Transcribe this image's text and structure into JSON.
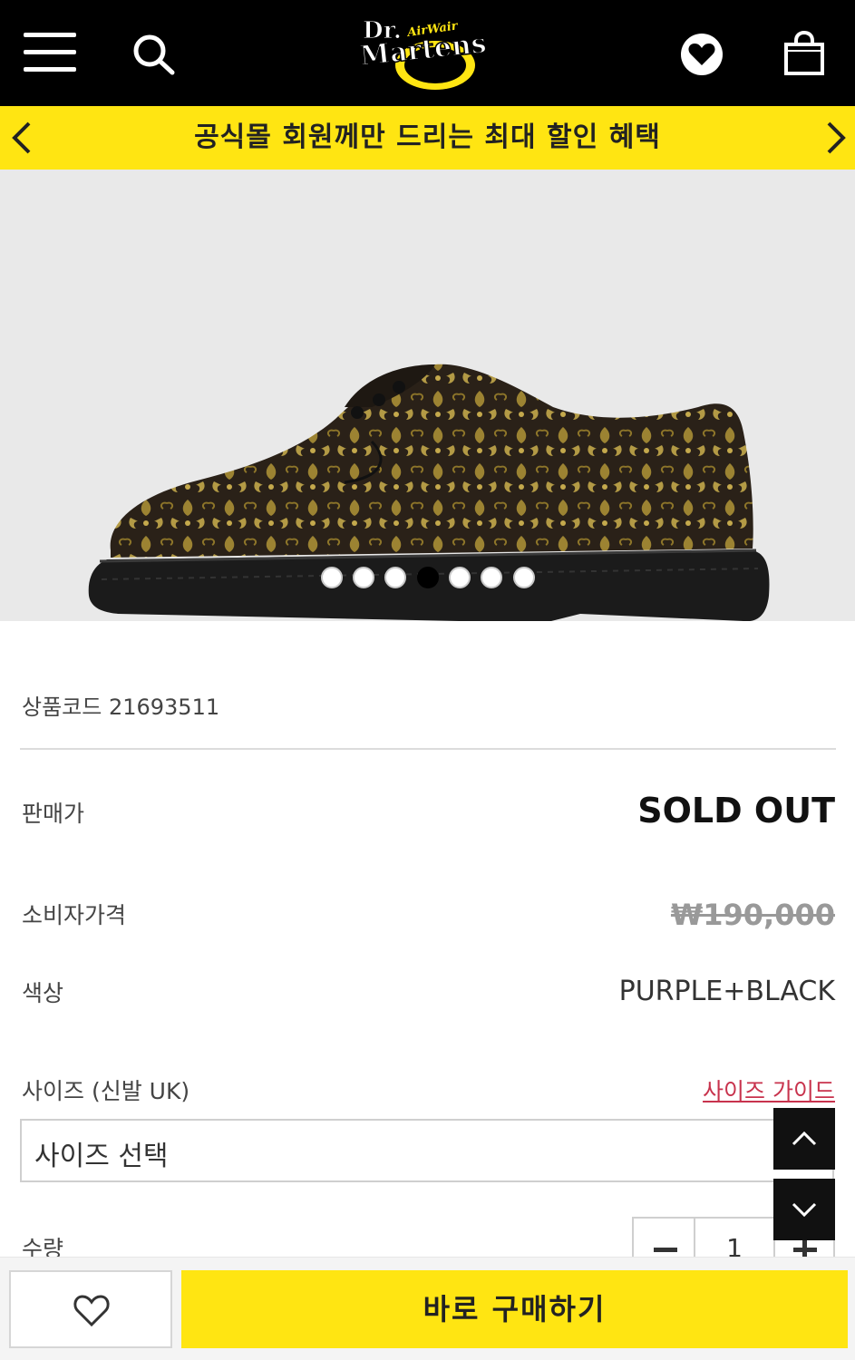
{
  "header": {
    "menu_icon": "hamburger-menu-icon",
    "search_icon": "search-icon",
    "logo_text": "Dr. Martens AirWair",
    "wishlist_icon": "heart-icon",
    "cart_icon": "shopping-bag-icon"
  },
  "promo": {
    "text": "공식몰 회원께만 드리는 최대 할인 혜택",
    "prev_icon": "chevron-left-icon",
    "next_icon": "chevron-right-icon"
  },
  "gallery": {
    "slide_count": 7,
    "active_index": 3
  },
  "product": {
    "code": "상품코드 21693511",
    "price_label": "판매가",
    "price_value": "SOLD OUT",
    "consumer_price_label": "소비자가격",
    "consumer_price_value": "₩190,000",
    "color_label": "색상",
    "color_value": "PURPLE+BLACK",
    "size_label": "사이즈 (신발 UK)",
    "size_guide": "사이즈 가이드",
    "size_select_placeholder": "사이즈 선택",
    "quantity_label": "수량",
    "quantity_value": "1"
  },
  "scroll": {
    "up_icon": "chevron-up-icon",
    "down_icon": "chevron-down-icon"
  },
  "bottom_bar": {
    "wishlist_icon": "heart-outline-icon",
    "buy_label": "바로 구매하기"
  },
  "colors": {
    "header_bg": "#000000",
    "accent_yellow": "#ffe512",
    "size_guide_red": "#c8334d"
  }
}
